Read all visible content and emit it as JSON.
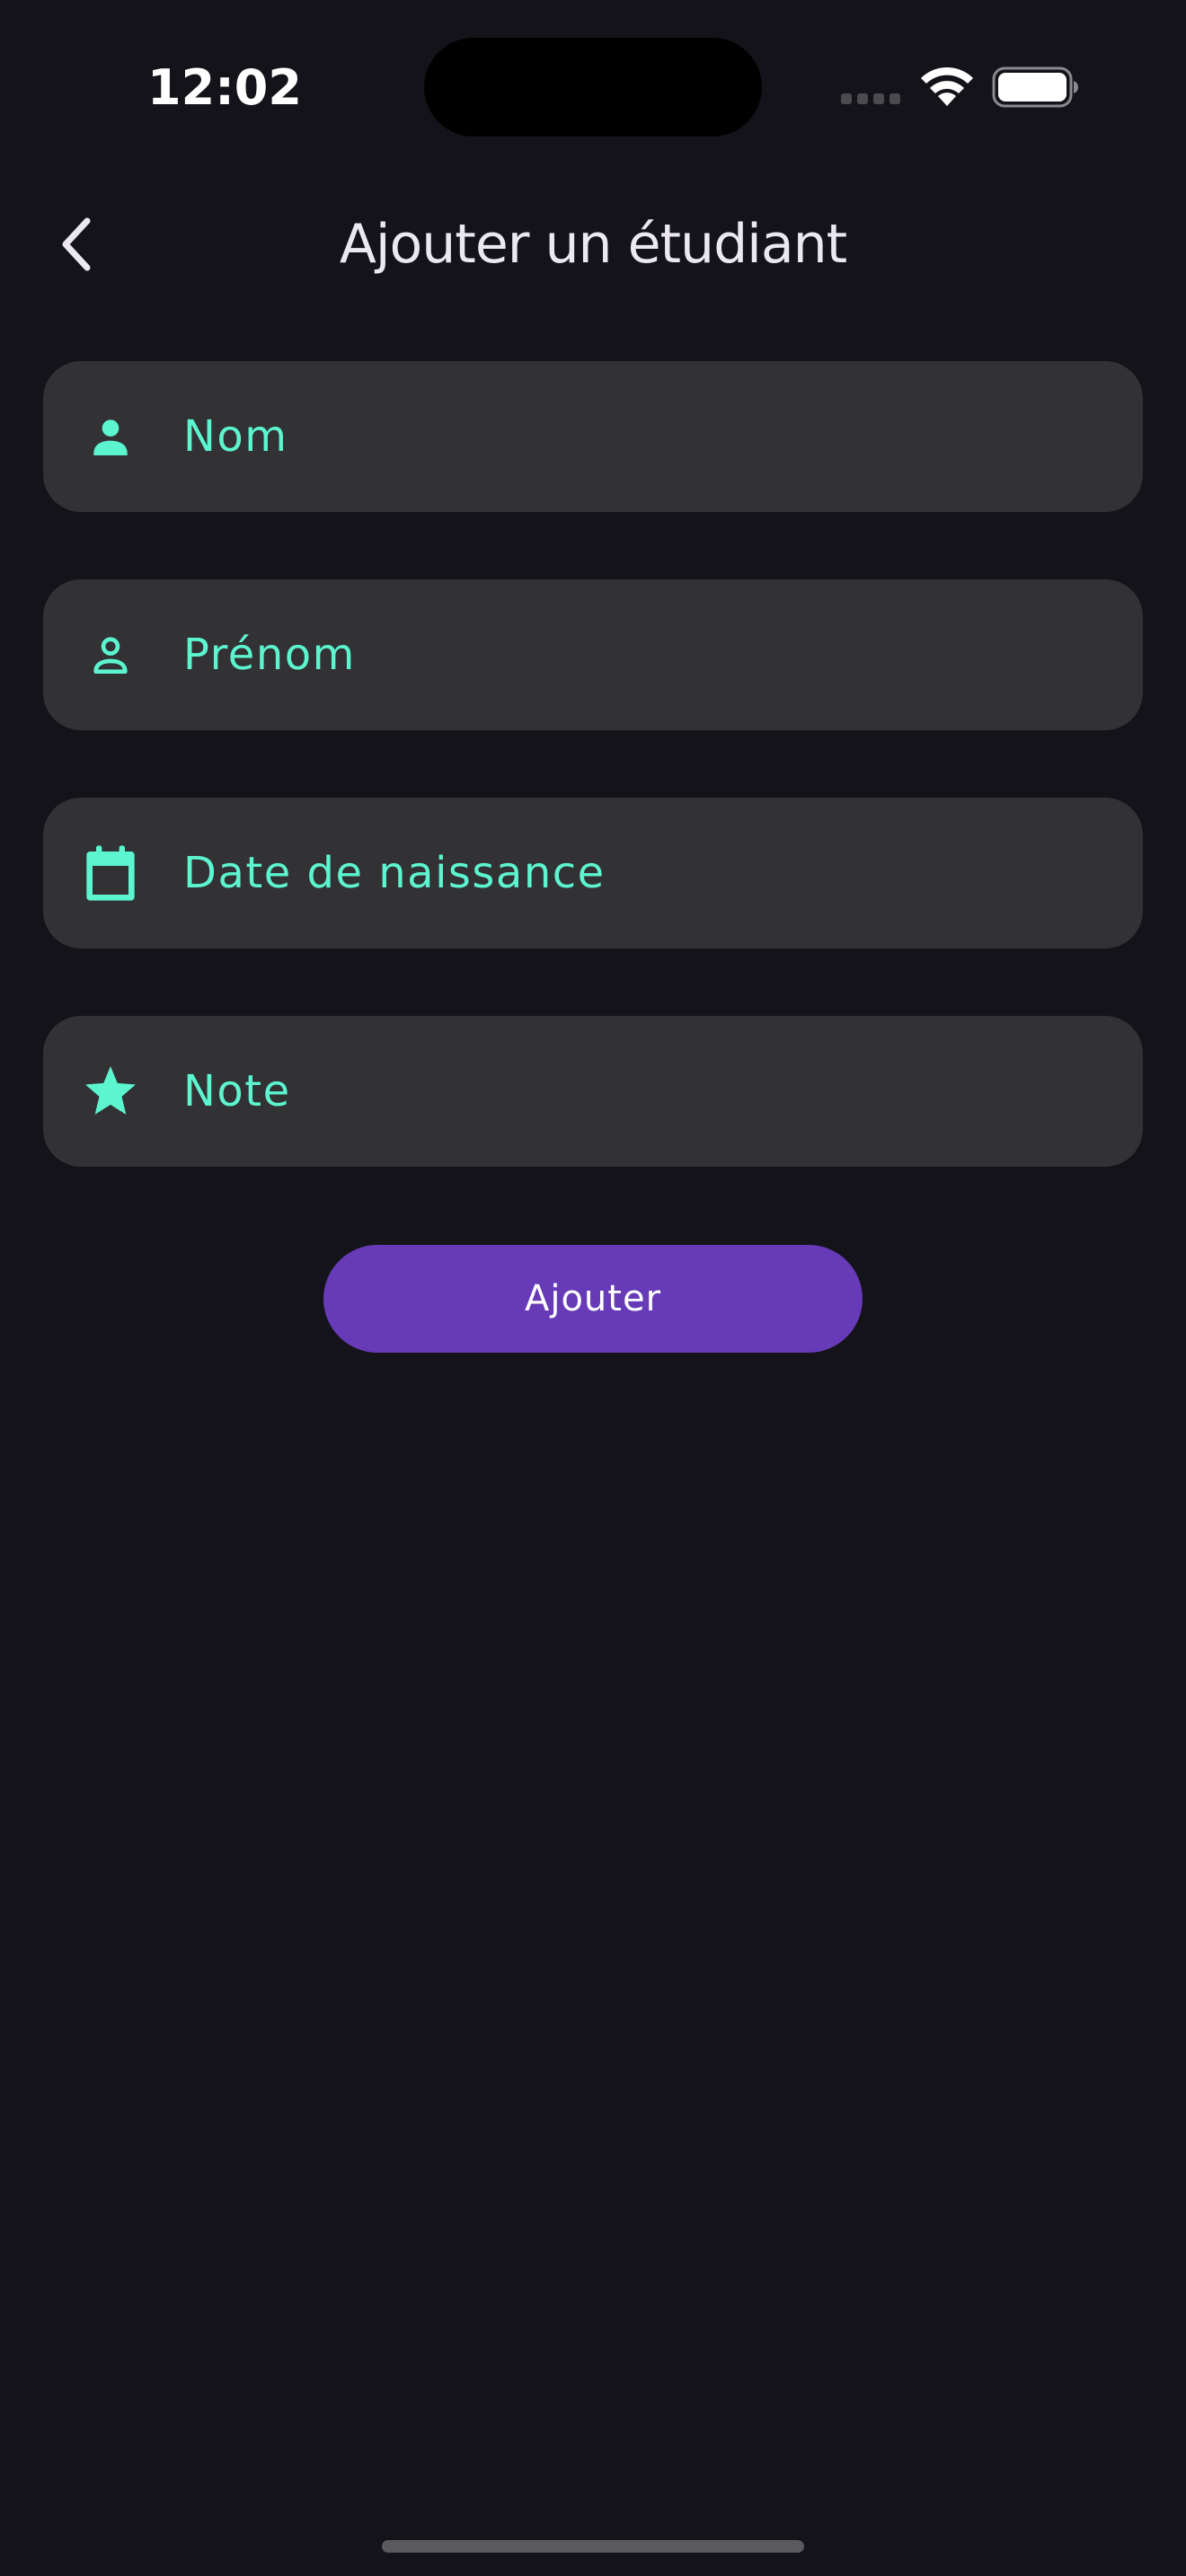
{
  "status_bar": {
    "time": "12:02",
    "icons": [
      "signal-dots-icon",
      "wifi-icon",
      "battery-icon"
    ]
  },
  "header": {
    "back_icon": "chevron-left-icon",
    "title": "Ajouter un étudiant"
  },
  "form": {
    "fields": [
      {
        "icon": "person-filled-icon",
        "placeholder": "Nom",
        "value": ""
      },
      {
        "icon": "person-outline-icon",
        "placeholder": "Prénom",
        "value": ""
      },
      {
        "icon": "calendar-icon",
        "placeholder": "Date de naissance",
        "value": ""
      },
      {
        "icon": "star-icon",
        "placeholder": "Note",
        "value": ""
      }
    ],
    "submit_label": "Ajouter"
  },
  "colors": {
    "background": "#15131a",
    "field_background": "#323133",
    "accent": "#5cf5d0",
    "button": "#673ab7",
    "title_text": "#ebe8f0"
  }
}
